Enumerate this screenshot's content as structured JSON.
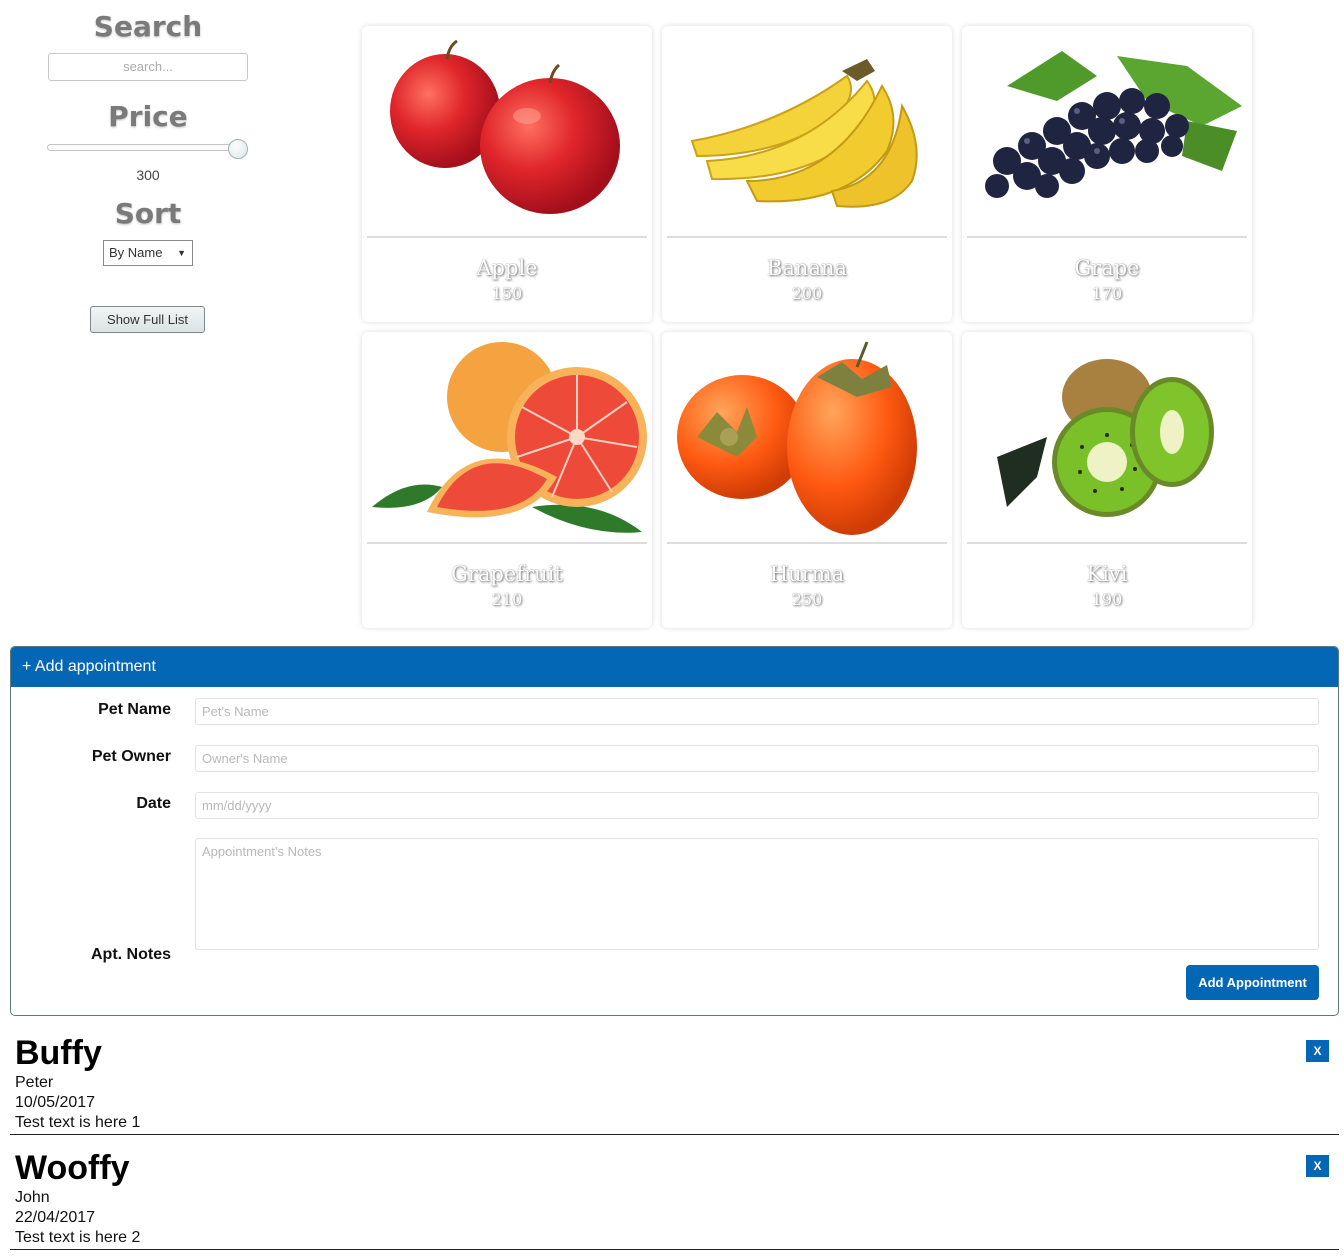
{
  "filter": {
    "search_title": "Search",
    "search_placeholder": "search...",
    "price_title": "Price",
    "price_value": "300",
    "price_slider_level": 1.0,
    "sort_title": "Sort",
    "sort_selected": "By Name",
    "full_list_label": "Show Full List"
  },
  "products": [
    {
      "name": "Apple",
      "price": "150",
      "icon": "apple-image"
    },
    {
      "name": "Banana",
      "price": "200",
      "icon": "banana-image"
    },
    {
      "name": "Grape",
      "price": "170",
      "icon": "grape-image"
    },
    {
      "name": "Grapefruit",
      "price": "210",
      "icon": "grapefruit-image"
    },
    {
      "name": "Hurma",
      "price": "250",
      "icon": "persimmon-image"
    },
    {
      "name": "Kivi",
      "price": "190",
      "icon": "kiwi-image"
    }
  ],
  "appointment_form": {
    "header": "+ Add appointment",
    "pet_name_label": "Pet Name",
    "pet_name_placeholder": "Pet's Name",
    "owner_label": "Pet Owner",
    "owner_placeholder": "Owner's Name",
    "date_label": "Date",
    "date_placeholder": "mm/dd/yyyy",
    "notes_label": "Apt. Notes",
    "notes_placeholder": "Appointment's Notes",
    "submit_label": "Add Appointment"
  },
  "appointments": [
    {
      "pet": "Buffy",
      "owner": "Peter",
      "date": "10/05/2017",
      "notes": "Test text is here 1",
      "delete_label": "X"
    },
    {
      "pet": "Wooffy",
      "owner": "John",
      "date": "22/04/2017",
      "notes": "Test text is here 2",
      "delete_label": "X"
    }
  ],
  "colors": {
    "accent": "#0467b5",
    "heading_gray": "#7a7a7a"
  }
}
